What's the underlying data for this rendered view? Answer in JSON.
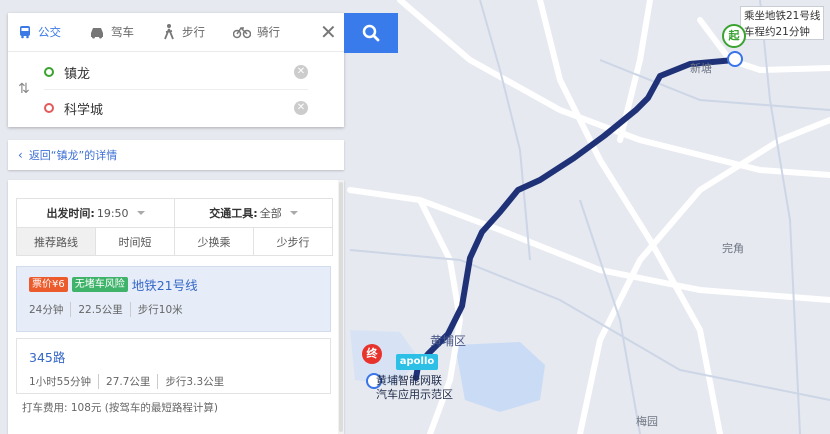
{
  "map": {
    "callout": {
      "line1": "乘坐地铁21号线",
      "line2": "车程约21分钟"
    },
    "start_pin": "起",
    "end_pin": "终",
    "labels": {
      "xintang": "新塘",
      "wanjiao": "完角",
      "huangpu": "黄埔区",
      "meiyuan": "梅园"
    },
    "apollo": "apollo",
    "zone": {
      "line1": "黄埔智能网联",
      "line2": "汽车应用示范区"
    },
    "route_color": "#1f3278"
  },
  "search": {
    "tabs": [
      {
        "label": "公交",
        "icon": "bus-icon",
        "active": true
      },
      {
        "label": "驾车",
        "icon": "car-icon",
        "active": false
      },
      {
        "label": "步行",
        "icon": "walk-icon",
        "active": false
      },
      {
        "label": "骑行",
        "icon": "bike-icon",
        "active": false
      }
    ],
    "origin": "镇龙",
    "destination": "科学城"
  },
  "back_link": "返回“镇龙”的详情",
  "filters": {
    "depart_label": "出发时间:",
    "depart_value": "19:50",
    "mode_label": "交通工具:",
    "mode_value": "全部",
    "sort_options": [
      "推荐路线",
      "时间短",
      "少换乘",
      "少步行"
    ]
  },
  "routes": [
    {
      "tags": [
        {
          "text": "票价¥6",
          "color": "#ec5b2c"
        },
        {
          "text": "无堵车风险",
          "color": "#3fb36a"
        }
      ],
      "name": "地铁21号线",
      "time": "24分钟",
      "distance": "22.5公里",
      "walk": "步行10米"
    },
    {
      "tags": [],
      "name": "345路",
      "time": "1小时55分钟",
      "distance": "27.7公里",
      "walk": "步行3.3公里"
    }
  ],
  "taxi_note": "打车费用: 108元 (按驾车的最短路程计算)"
}
